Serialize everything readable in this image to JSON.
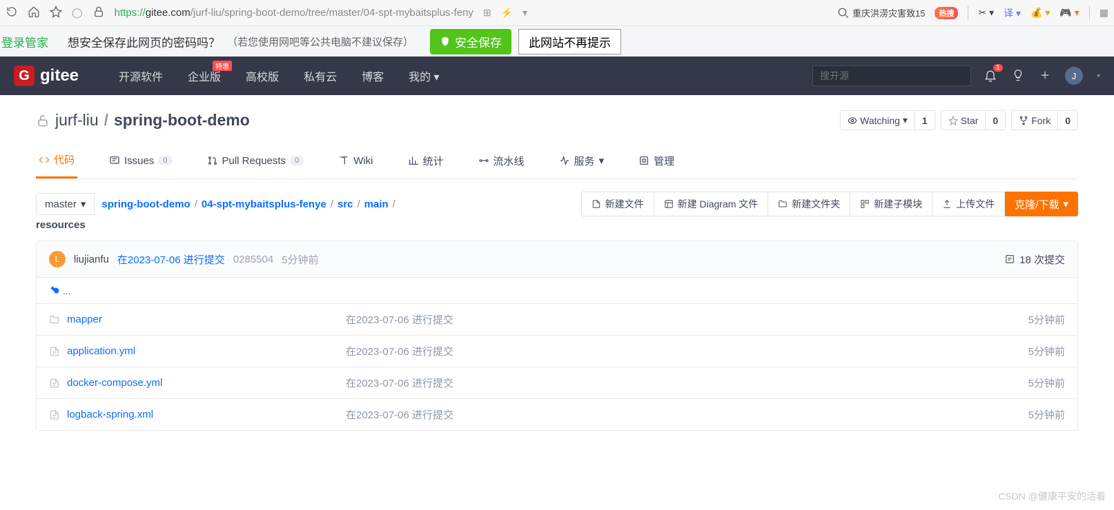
{
  "browser": {
    "url_proto": "https://",
    "url_host": "gitee.com",
    "url_path": "/jurf-liu/spring-boot-demo/tree/master/04-spt-mybaitsplus-feny",
    "search_text": "重庆洪涝灾害致15",
    "hot_label": "热搜"
  },
  "save_bar": {
    "manager": "登录管家",
    "question": "想安全保存此网页的密码吗？",
    "note": "（若您使用网吧等公共电脑不建议保存）",
    "save_btn": "安全保存",
    "no_show": "此网站不再提示"
  },
  "nav": {
    "items": [
      "开源软件",
      "企业版",
      "高校版",
      "私有云",
      "博客",
      "我的"
    ],
    "badge": "特惠",
    "search_placeholder": "搜开源",
    "bell_count": "1",
    "avatar": "J"
  },
  "repo": {
    "owner": "jurf-liu",
    "name": "spring-boot-demo",
    "watch_label": "Watching",
    "watch_count": "1",
    "star_label": "Star",
    "star_count": "0",
    "fork_label": "Fork",
    "fork_count": "0"
  },
  "tabs": {
    "code": "代码",
    "issues": "Issues",
    "issues_count": "0",
    "pr": "Pull Requests",
    "pr_count": "0",
    "wiki": "Wiki",
    "stats": "统计",
    "pipeline": "流水线",
    "services": "服务",
    "manage": "管理"
  },
  "toolbar": {
    "branch": "master",
    "bc1": "spring-boot-demo",
    "bc2": "04-spt-mybaitsplus-fenye",
    "bc3": "src",
    "bc4": "main",
    "rest": "resources",
    "new_file": "新建文件",
    "new_diagram": "新建 Diagram 文件",
    "new_folder": "新建文件夹",
    "new_submodule": "新建子模块",
    "upload": "上传文件",
    "clone": "克隆/下载"
  },
  "commit": {
    "avatar": "L",
    "author": "liujianfu",
    "msg": "在2023-07-06 进行提交",
    "hash": "0285504",
    "time": "5分钟前",
    "count_label": "18 次提交",
    "back": "..."
  },
  "files": [
    {
      "type": "folder",
      "name": "mapper",
      "msg": "在2023-07-06 进行提交",
      "time": "5分钟前"
    },
    {
      "type": "file",
      "name": "application.yml",
      "msg": "在2023-07-06 进行提交",
      "time": "5分钟前"
    },
    {
      "type": "file",
      "name": "docker-compose.yml",
      "msg": "在2023-07-06 进行提交",
      "time": "5分钟前"
    },
    {
      "type": "file",
      "name": "logback-spring.xml",
      "msg": "在2023-07-06 进行提交",
      "time": "5分钟前"
    }
  ],
  "watermark": "CSDN @健康平安的活着"
}
